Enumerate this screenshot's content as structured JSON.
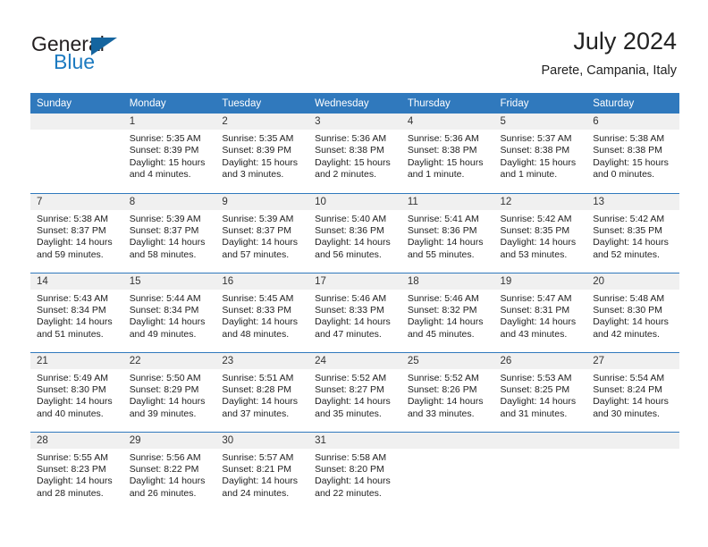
{
  "brand": {
    "word1": "General",
    "word2": "Blue",
    "color_dark": "#231f20",
    "color_blue": "#1c7ac0",
    "triangle_color": "#15659f"
  },
  "header": {
    "title": "July 2024",
    "subtitle": "Parete, Campania, Italy"
  },
  "theme": {
    "header_bg": "#3079bd",
    "daynum_bg": "#f0f0f0",
    "grid_line": "#3079bd"
  },
  "weekday_headers": [
    "Sunday",
    "Monday",
    "Tuesday",
    "Wednesday",
    "Thursday",
    "Friday",
    "Saturday"
  ],
  "weeks": [
    [
      {
        "day": "",
        "sunrise": "",
        "sunset": "",
        "daylight_line1": "",
        "daylight_line2": ""
      },
      {
        "day": "1",
        "sunrise": "Sunrise: 5:35 AM",
        "sunset": "Sunset: 8:39 PM",
        "daylight_line1": "Daylight: 15 hours",
        "daylight_line2": "and 4 minutes."
      },
      {
        "day": "2",
        "sunrise": "Sunrise: 5:35 AM",
        "sunset": "Sunset: 8:39 PM",
        "daylight_line1": "Daylight: 15 hours",
        "daylight_line2": "and 3 minutes."
      },
      {
        "day": "3",
        "sunrise": "Sunrise: 5:36 AM",
        "sunset": "Sunset: 8:38 PM",
        "daylight_line1": "Daylight: 15 hours",
        "daylight_line2": "and 2 minutes."
      },
      {
        "day": "4",
        "sunrise": "Sunrise: 5:36 AM",
        "sunset": "Sunset: 8:38 PM",
        "daylight_line1": "Daylight: 15 hours",
        "daylight_line2": "and 1 minute."
      },
      {
        "day": "5",
        "sunrise": "Sunrise: 5:37 AM",
        "sunset": "Sunset: 8:38 PM",
        "daylight_line1": "Daylight: 15 hours",
        "daylight_line2": "and 1 minute."
      },
      {
        "day": "6",
        "sunrise": "Sunrise: 5:38 AM",
        "sunset": "Sunset: 8:38 PM",
        "daylight_line1": "Daylight: 15 hours",
        "daylight_line2": "and 0 minutes."
      }
    ],
    [
      {
        "day": "7",
        "sunrise": "Sunrise: 5:38 AM",
        "sunset": "Sunset: 8:37 PM",
        "daylight_line1": "Daylight: 14 hours",
        "daylight_line2": "and 59 minutes."
      },
      {
        "day": "8",
        "sunrise": "Sunrise: 5:39 AM",
        "sunset": "Sunset: 8:37 PM",
        "daylight_line1": "Daylight: 14 hours",
        "daylight_line2": "and 58 minutes."
      },
      {
        "day": "9",
        "sunrise": "Sunrise: 5:39 AM",
        "sunset": "Sunset: 8:37 PM",
        "daylight_line1": "Daylight: 14 hours",
        "daylight_line2": "and 57 minutes."
      },
      {
        "day": "10",
        "sunrise": "Sunrise: 5:40 AM",
        "sunset": "Sunset: 8:36 PM",
        "daylight_line1": "Daylight: 14 hours",
        "daylight_line2": "and 56 minutes."
      },
      {
        "day": "11",
        "sunrise": "Sunrise: 5:41 AM",
        "sunset": "Sunset: 8:36 PM",
        "daylight_line1": "Daylight: 14 hours",
        "daylight_line2": "and 55 minutes."
      },
      {
        "day": "12",
        "sunrise": "Sunrise: 5:42 AM",
        "sunset": "Sunset: 8:35 PM",
        "daylight_line1": "Daylight: 14 hours",
        "daylight_line2": "and 53 minutes."
      },
      {
        "day": "13",
        "sunrise": "Sunrise: 5:42 AM",
        "sunset": "Sunset: 8:35 PM",
        "daylight_line1": "Daylight: 14 hours",
        "daylight_line2": "and 52 minutes."
      }
    ],
    [
      {
        "day": "14",
        "sunrise": "Sunrise: 5:43 AM",
        "sunset": "Sunset: 8:34 PM",
        "daylight_line1": "Daylight: 14 hours",
        "daylight_line2": "and 51 minutes."
      },
      {
        "day": "15",
        "sunrise": "Sunrise: 5:44 AM",
        "sunset": "Sunset: 8:34 PM",
        "daylight_line1": "Daylight: 14 hours",
        "daylight_line2": "and 49 minutes."
      },
      {
        "day": "16",
        "sunrise": "Sunrise: 5:45 AM",
        "sunset": "Sunset: 8:33 PM",
        "daylight_line1": "Daylight: 14 hours",
        "daylight_line2": "and 48 minutes."
      },
      {
        "day": "17",
        "sunrise": "Sunrise: 5:46 AM",
        "sunset": "Sunset: 8:33 PM",
        "daylight_line1": "Daylight: 14 hours",
        "daylight_line2": "and 47 minutes."
      },
      {
        "day": "18",
        "sunrise": "Sunrise: 5:46 AM",
        "sunset": "Sunset: 8:32 PM",
        "daylight_line1": "Daylight: 14 hours",
        "daylight_line2": "and 45 minutes."
      },
      {
        "day": "19",
        "sunrise": "Sunrise: 5:47 AM",
        "sunset": "Sunset: 8:31 PM",
        "daylight_line1": "Daylight: 14 hours",
        "daylight_line2": "and 43 minutes."
      },
      {
        "day": "20",
        "sunrise": "Sunrise: 5:48 AM",
        "sunset": "Sunset: 8:30 PM",
        "daylight_line1": "Daylight: 14 hours",
        "daylight_line2": "and 42 minutes."
      }
    ],
    [
      {
        "day": "21",
        "sunrise": "Sunrise: 5:49 AM",
        "sunset": "Sunset: 8:30 PM",
        "daylight_line1": "Daylight: 14 hours",
        "daylight_line2": "and 40 minutes."
      },
      {
        "day": "22",
        "sunrise": "Sunrise: 5:50 AM",
        "sunset": "Sunset: 8:29 PM",
        "daylight_line1": "Daylight: 14 hours",
        "daylight_line2": "and 39 minutes."
      },
      {
        "day": "23",
        "sunrise": "Sunrise: 5:51 AM",
        "sunset": "Sunset: 8:28 PM",
        "daylight_line1": "Daylight: 14 hours",
        "daylight_line2": "and 37 minutes."
      },
      {
        "day": "24",
        "sunrise": "Sunrise: 5:52 AM",
        "sunset": "Sunset: 8:27 PM",
        "daylight_line1": "Daylight: 14 hours",
        "daylight_line2": "and 35 minutes."
      },
      {
        "day": "25",
        "sunrise": "Sunrise: 5:52 AM",
        "sunset": "Sunset: 8:26 PM",
        "daylight_line1": "Daylight: 14 hours",
        "daylight_line2": "and 33 minutes."
      },
      {
        "day": "26",
        "sunrise": "Sunrise: 5:53 AM",
        "sunset": "Sunset: 8:25 PM",
        "daylight_line1": "Daylight: 14 hours",
        "daylight_line2": "and 31 minutes."
      },
      {
        "day": "27",
        "sunrise": "Sunrise: 5:54 AM",
        "sunset": "Sunset: 8:24 PM",
        "daylight_line1": "Daylight: 14 hours",
        "daylight_line2": "and 30 minutes."
      }
    ],
    [
      {
        "day": "28",
        "sunrise": "Sunrise: 5:55 AM",
        "sunset": "Sunset: 8:23 PM",
        "daylight_line1": "Daylight: 14 hours",
        "daylight_line2": "and 28 minutes."
      },
      {
        "day": "29",
        "sunrise": "Sunrise: 5:56 AM",
        "sunset": "Sunset: 8:22 PM",
        "daylight_line1": "Daylight: 14 hours",
        "daylight_line2": "and 26 minutes."
      },
      {
        "day": "30",
        "sunrise": "Sunrise: 5:57 AM",
        "sunset": "Sunset: 8:21 PM",
        "daylight_line1": "Daylight: 14 hours",
        "daylight_line2": "and 24 minutes."
      },
      {
        "day": "31",
        "sunrise": "Sunrise: 5:58 AM",
        "sunset": "Sunset: 8:20 PM",
        "daylight_line1": "Daylight: 14 hours",
        "daylight_line2": "and 22 minutes."
      },
      {
        "day": "",
        "sunrise": "",
        "sunset": "",
        "daylight_line1": "",
        "daylight_line2": ""
      },
      {
        "day": "",
        "sunrise": "",
        "sunset": "",
        "daylight_line1": "",
        "daylight_line2": ""
      },
      {
        "day": "",
        "sunrise": "",
        "sunset": "",
        "daylight_line1": "",
        "daylight_line2": ""
      }
    ]
  ]
}
